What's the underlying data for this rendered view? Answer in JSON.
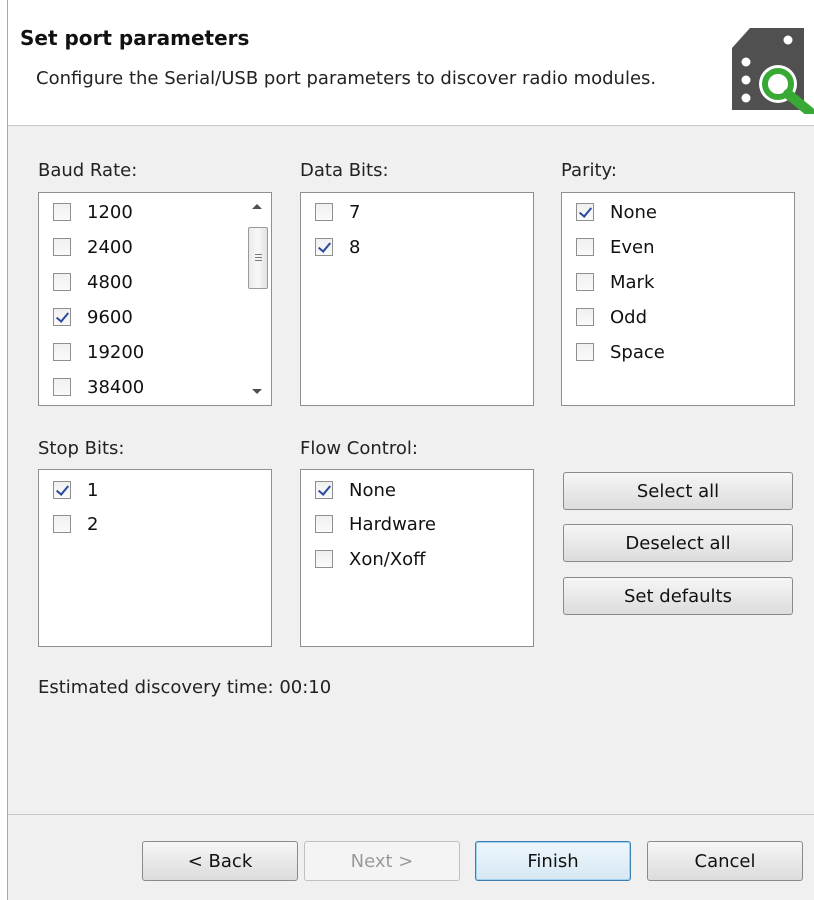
{
  "header": {
    "title": "Set port parameters",
    "description": "Configure the Serial/USB port parameters to discover radio modules.",
    "icon": "serial-port-search-icon"
  },
  "baud_rate": {
    "label": "Baud Rate:",
    "items": [
      {
        "label": "1200",
        "checked": false
      },
      {
        "label": "2400",
        "checked": false
      },
      {
        "label": "4800",
        "checked": false
      },
      {
        "label": "9600",
        "checked": true
      },
      {
        "label": "19200",
        "checked": false
      },
      {
        "label": "38400",
        "checked": false
      }
    ]
  },
  "data_bits": {
    "label": "Data Bits:",
    "items": [
      {
        "label": "7",
        "checked": false
      },
      {
        "label": "8",
        "checked": true
      }
    ]
  },
  "parity": {
    "label": "Parity:",
    "items": [
      {
        "label": "None",
        "checked": true
      },
      {
        "label": "Even",
        "checked": false
      },
      {
        "label": "Mark",
        "checked": false
      },
      {
        "label": "Odd",
        "checked": false
      },
      {
        "label": "Space",
        "checked": false
      }
    ]
  },
  "stop_bits": {
    "label": "Stop Bits:",
    "items": [
      {
        "label": "1",
        "checked": true
      },
      {
        "label": "2",
        "checked": false
      }
    ]
  },
  "flow_control": {
    "label": "Flow Control:",
    "items": [
      {
        "label": "None",
        "checked": true
      },
      {
        "label": "Hardware",
        "checked": false
      },
      {
        "label": "Xon/Xoff",
        "checked": false
      }
    ]
  },
  "actions": {
    "select_all": "Select all",
    "deselect_all": "Deselect all",
    "set_defaults": "Set defaults"
  },
  "estimated": "Estimated discovery time: 00:10",
  "footer": {
    "back": "< Back",
    "next": "Next >",
    "finish": "Finish",
    "cancel": "Cancel"
  },
  "colors": {
    "icon_body": "#505050",
    "icon_magnifier": "#39a935",
    "check_mark": "#2a4aa0",
    "default_button_border": "#3c7fb1"
  }
}
